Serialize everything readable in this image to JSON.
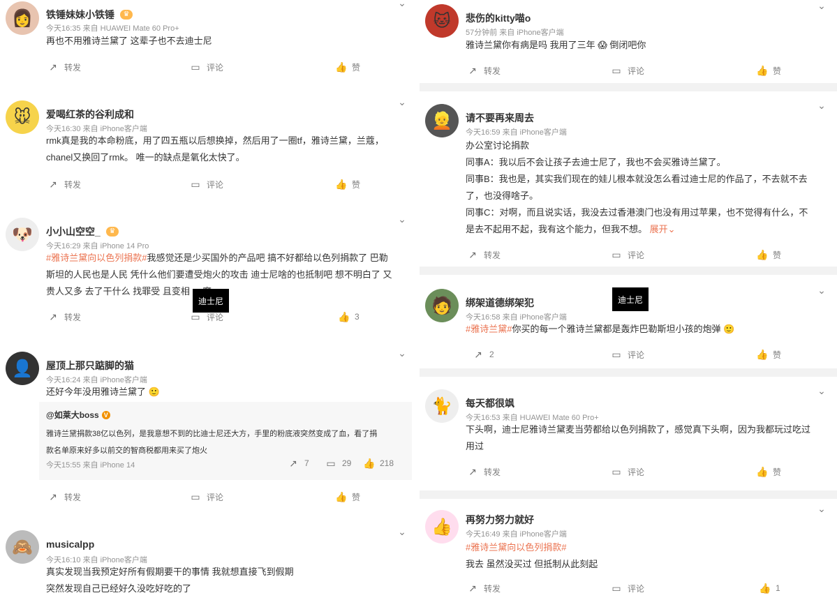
{
  "left": [
    {
      "name": "铁锤妹妹小铁锤",
      "meta": "今天16:35  来自 HUAWEI Mate 60 Pro+",
      "lines": [
        "再也不用雅诗兰黛了 这辈子也不去迪士尼"
      ],
      "repost": "转发",
      "comment": "评论",
      "like": "赞"
    },
    {
      "name": "爱喝红茶的谷利成和",
      "meta": "今天16:30  来自 iPhone客户端",
      "lines": [
        "rmk真是我的本命粉底，用了四五瓶以后想换掉，然后用了一圈tf，雅诗兰黛，兰蔻，",
        "chanel又换回了rmk。 唯一的缺点是氧化太快了。"
      ],
      "repost": "转发",
      "comment": "评论",
      "like": "赞"
    },
    {
      "name": "小小山空空_",
      "meta": "今天16:29  来自 iPhone 14 Pro",
      "tag": "#雅诗兰黛向以色列捐款#",
      "lines": [
        "我感觉还是少买国外的产品吧 搞不好都给以色列捐款了 巴勒",
        "斯坦的人民也是人民 凭什么他们要遭受炮火的攻击 迪士尼啥的也抵制吧 想不明白了 又",
        "贵人又多 去了干什么 找罪受 且变相 ... 魔"
      ],
      "overlay": "迪士尼",
      "repost": "转发",
      "comment": "评论",
      "like": "3"
    },
    {
      "name": "屋顶上那只踮脚的猫",
      "meta": "今天16:24  来自 iPhone客户端",
      "lines": [
        "还好今年没用雅诗兰黛了 🙂"
      ],
      "quote": {
        "name": "@如莱大boss",
        "lines": [
          "雅诗兰黛捐款38亿以色列，是我意想不到的比迪士尼还大方，手里的粉底液突然变成了血，看了捐",
          "款名单原来好多以前交的智商税都用来买了炮火"
        ],
        "meta": "今天15:55  来自 iPhone 14",
        "reposts": "7",
        "comments": "29",
        "likes": "218"
      },
      "repost": "转发",
      "comment": "评论",
      "like": "赞"
    },
    {
      "name": "musicalpp",
      "meta": "今天16:10  来自 iPhone客户端",
      "lines": [
        "真实发现当我预定好所有假期要干的事情 我就想直接飞到假期",
        "突然发现自己已经好久没吃好吃的了"
      ]
    }
  ],
  "right": [
    {
      "name": "悲伤的kitty喵o",
      "meta": "57分钟前  来自 iPhone客户端",
      "lines": [
        "雅诗兰黛你有病是吗 我用了三年 😱 倒闭吧你"
      ],
      "repost": "转发",
      "comment": "评论",
      "like": "赞"
    },
    {
      "name": "请不要再来周去",
      "meta": "今天16:59  来自 iPhone客户端",
      "lines": [
        "办公室讨论捐款",
        "同事A：我以后不会让孩子去迪士尼了，我也不会买雅诗兰黛了。",
        "同事B：我也是，其实我们现在的娃儿根本就没怎么看过迪士尼的作品了，不去就不去",
        "了，也没得啥子。",
        "同事C：对啊，而且说实话，我没去过香港澳门也没有用过苹果，也不觉得有什么，不",
        "是去不起用不起，我有这个能力，但我不想。"
      ],
      "more": "展开",
      "repost": "转发",
      "comment": "评论",
      "like": "赞"
    },
    {
      "name": "绑架道德绑架犯",
      "meta": "今天16:58  来自 iPhone客户端",
      "tag": "#雅诗兰黛#",
      "lines": [
        "你买的每一个雅诗兰黛都是轰炸巴勒斯坦小孩的炮弹 🙂"
      ],
      "overlay": "迪士尼",
      "repost": "2",
      "comment": "评论",
      "like": "赞"
    },
    {
      "name": "每天都很飒",
      "meta": "今天16:53  来自 HUAWEI Mate 60 Pro+",
      "lines": [
        "下头啊，迪士尼雅诗兰黛麦当劳都给以色列捐款了，感觉真下头啊，因为我都玩过吃过",
        "用过"
      ],
      "repost": "转发",
      "comment": "评论",
      "like": "赞"
    },
    {
      "name": "再努力努力就好",
      "meta": "今天16:49  来自 iPhone客户端",
      "tag": "#雅诗兰黛向以色列捐款#",
      "lines": [
        "我去 虽然没买过 但抵制从此刻起"
      ],
      "repost": "转发",
      "comment": "评论",
      "like": "1"
    }
  ]
}
